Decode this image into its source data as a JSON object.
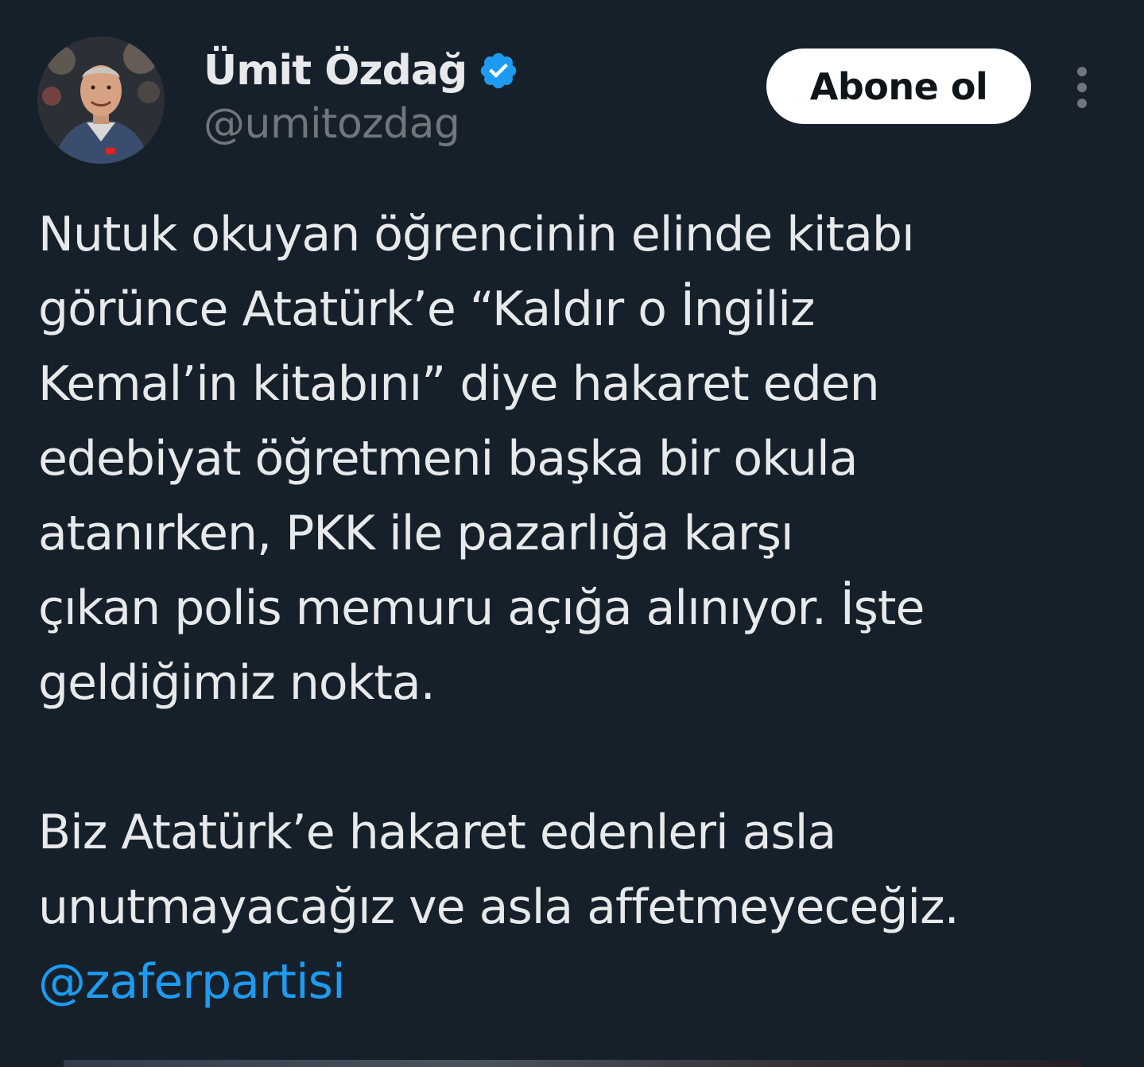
{
  "user": {
    "display_name": "Ümit Özdağ",
    "handle": "@umitozdag",
    "verified": true,
    "verified_color": "#1d9bf0"
  },
  "actions": {
    "follow_label": "Abone ol",
    "more_icon": "more-vertical-icon"
  },
  "tweet": {
    "paragraph1": [
      "Nutuk okuyan öğrencinin elinde kitabı",
      "görünce Atatürk’e “Kaldır o İngiliz",
      "Kemal’in kitabını” diye hakaret eden",
      "edebiyat öğretmeni başka bir okula",
      "atanırken, PKK ile pazarlığa karşı",
      "çıkan polis memuru açığa alınıyor. İşte",
      "geldiğimiz nokta."
    ],
    "paragraph2": [
      "Biz Atatürk’e hakaret edenleri asla",
      "unutmayacağız ve asla affetmeyeceğiz."
    ],
    "mention": "@zaferpartisi"
  },
  "colors": {
    "background": "#16202b",
    "text_primary": "#e7e9ea",
    "text_secondary": "#71767b",
    "link": "#1d9bf0",
    "button_bg": "#ffffff",
    "button_text": "#0f1419"
  }
}
